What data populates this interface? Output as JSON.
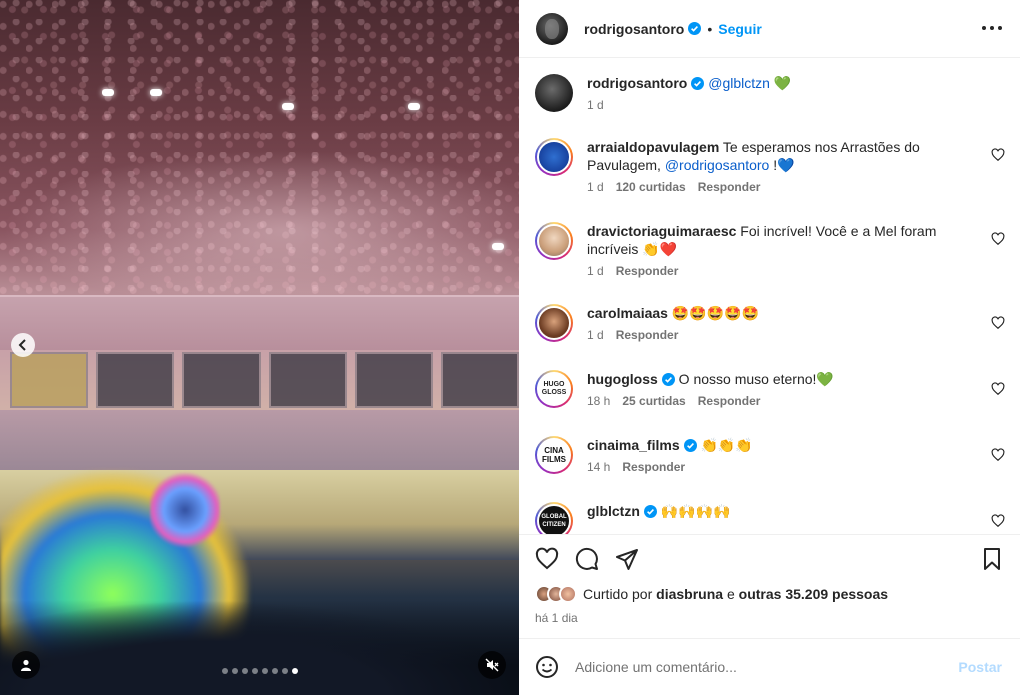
{
  "colors": {
    "accent": "#0095f6",
    "text": "#262626",
    "muted": "#737373",
    "post_disabled": "#b3dbff",
    "like_red": "#ed4956"
  },
  "media": {
    "nav_prev_icon": "chevron-left-icon",
    "carousel_dots": 8,
    "active_dot_index": 7
  },
  "header": {
    "username": "rodrigosantoro",
    "separator": "•",
    "follow_label": "Seguir"
  },
  "caption": {
    "username": "rodrigosantoro",
    "text": "@glblctzn 💚",
    "time": "1 d"
  },
  "comments": [
    {
      "username": "arraialdopavulagem",
      "text": "Te esperamos nos Arrastões do Pavulagem, ",
      "mention": "@rodrigosantoro",
      "suffix": " !💙",
      "time": "1 d",
      "likes": "120 curtidas",
      "reply": "Responder"
    },
    {
      "username": "dravictoriaguimaraesc",
      "text": "Foi incrível! Você e a Mel foram incríveis 👏❤️",
      "time": "1 d",
      "reply": "Responder"
    },
    {
      "username": "carolmaiaas",
      "text": "🤩🤩🤩🤩🤩",
      "time": "1 d",
      "reply": "Responder"
    },
    {
      "username": "hugogloss",
      "text": "O nosso muso eterno!💚",
      "time": "18 h",
      "likes": "25 curtidas",
      "reply": "Responder",
      "avatar_text": "HUGO GLOSS"
    },
    {
      "username": "cinaima_films",
      "text": "👏👏👏",
      "time": "14 h",
      "reply": "Responder",
      "avatar_text": "CINA FILMS"
    },
    {
      "username": "glblctzn",
      "text": "🙌🙌🙌🙌",
      "avatar_text": "GLOBAL CITIZEN"
    }
  ],
  "likes": {
    "prefix": "Curtido por ",
    "user": "diasbruna",
    "middle": " e ",
    "others": "outras 35.209 pessoas"
  },
  "timestamp": "há 1 dia",
  "add_comment": {
    "placeholder": "Adicione um comentário...",
    "post_label": "Postar"
  }
}
